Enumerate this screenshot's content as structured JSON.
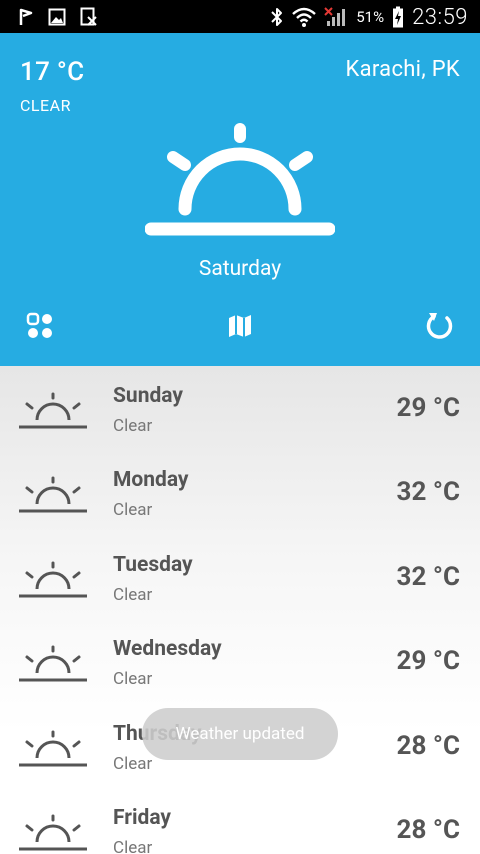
{
  "status_bar": {
    "battery_percent": "51%",
    "time": "23:59"
  },
  "current": {
    "temperature": "17 °C",
    "condition": "CLEAR",
    "location": "Karachi, PK",
    "day": "Saturday"
  },
  "forecast": [
    {
      "day": "Sunday",
      "condition": "Clear",
      "temperature": "29 °C"
    },
    {
      "day": "Monday",
      "condition": "Clear",
      "temperature": "32 °C"
    },
    {
      "day": "Tuesday",
      "condition": "Clear",
      "temperature": "32 °C"
    },
    {
      "day": "Wednesday",
      "condition": "Clear",
      "temperature": "29 °C"
    },
    {
      "day": "Thursday",
      "condition": "Clear",
      "temperature": "28 °C"
    },
    {
      "day": "Friday",
      "condition": "Clear",
      "temperature": "28 °C"
    }
  ],
  "toast": {
    "message": "Weather updated"
  },
  "icons": {
    "weather": "sunrise-icon",
    "actions": [
      "grid-icon",
      "map-icon",
      "refresh-icon"
    ]
  },
  "colors": {
    "header_bg": "#26ACE2",
    "text_primary": "#555555",
    "text_secondary": "#777777"
  }
}
